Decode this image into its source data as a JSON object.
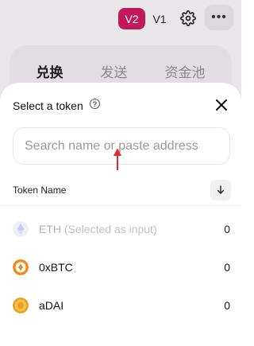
{
  "header": {
    "version_active": "V2",
    "version_other": "V1",
    "icons": [
      "gear-icon",
      "more-icon"
    ],
    "more_label": "•••"
  },
  "swap_card": {
    "tabs": [
      {
        "label": "兑换",
        "active": true
      },
      {
        "label": "发送",
        "active": false
      },
      {
        "label": "资金池",
        "active": false
      }
    ]
  },
  "modal": {
    "title": "Select a token",
    "help_label": "?",
    "search": {
      "placeholder": "Search name or paste address",
      "value": ""
    },
    "list_header": "Token Name",
    "tokens": [
      {
        "symbol": "ETH",
        "note": "(Selected as input)",
        "balance": "0",
        "disabled": true,
        "icon": "eth-icon"
      },
      {
        "symbol": "0xBTC",
        "note": "",
        "balance": "0",
        "disabled": false,
        "icon": "0xbtc-icon"
      },
      {
        "symbol": "aDAI",
        "note": "",
        "balance": "0",
        "disabled": false,
        "icon": "adai-icon"
      }
    ]
  },
  "colors": {
    "accent": "#c2185b",
    "backdrop": "#e9e6ea"
  }
}
